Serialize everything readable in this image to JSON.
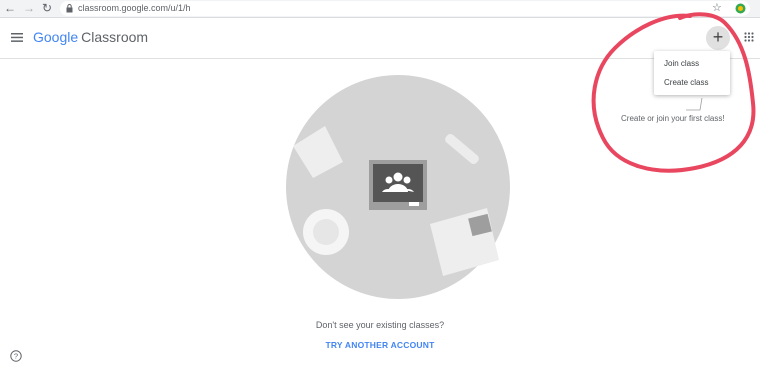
{
  "browser": {
    "url": "classroom.google.com/u/1/h",
    "back_icon": "arrow-left",
    "forward_icon": "arrow-right",
    "reload_icon": "reload",
    "bookmark_icon": "star",
    "extension_icon": "puzzle-ext"
  },
  "header": {
    "logo_google": "Google",
    "logo_product": "Classroom",
    "add_button_label": "+"
  },
  "menu": {
    "join_class": "Join class",
    "create_class": "Create class"
  },
  "hint": "Create or join your first class!",
  "footer": {
    "question": "Don't see your existing classes?",
    "link": "TRY ANOTHER ACCOUNT"
  },
  "colors": {
    "accent": "#4285f4",
    "annotation": "#e8475f"
  }
}
